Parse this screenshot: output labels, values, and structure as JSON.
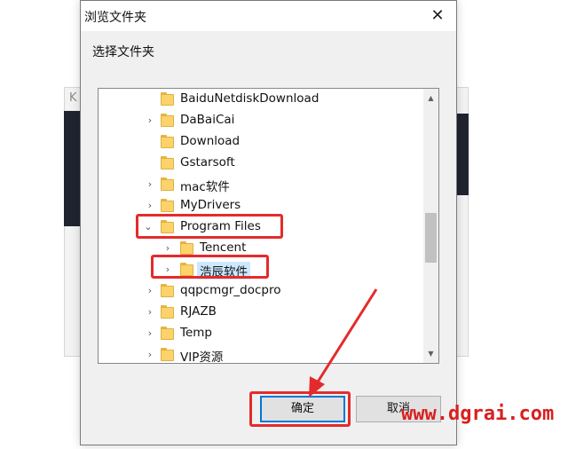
{
  "dialog": {
    "title": "浏览文件夹",
    "close_label": "✕",
    "prompt": "选择文件夹",
    "ok_label": "确定",
    "cancel_label": "取消"
  },
  "background": {
    "letter": "K"
  },
  "tree": {
    "items": [
      {
        "label": "BaiduNetdiskDownload",
        "expander": ""
      },
      {
        "label": "DaBaiCai",
        "expander": "›"
      },
      {
        "label": "Download",
        "expander": ""
      },
      {
        "label": "Gstarsoft",
        "expander": ""
      },
      {
        "label": "mac软件",
        "expander": "›"
      },
      {
        "label": "MyDrivers",
        "expander": "›"
      },
      {
        "label": "Program Files",
        "expander": "⌄"
      },
      {
        "label": "Tencent",
        "expander": "›"
      },
      {
        "label": "浩辰软件",
        "expander": "›"
      },
      {
        "label": "qqpcmgr_docpro",
        "expander": "›"
      },
      {
        "label": "RJAZB",
        "expander": "›"
      },
      {
        "label": "Temp",
        "expander": "›"
      },
      {
        "label": "VIP资源",
        "expander": "›"
      }
    ],
    "selected_item": "浩辰软件"
  },
  "scrollbar": {
    "up_icon": "▲",
    "down_icon": "▼"
  },
  "watermark": "www.dgrai.com",
  "colors": {
    "annotation_red": "#e42b2b",
    "selection_bg": "#cce8ff",
    "folder_yellow": "#fcd36a",
    "focus_blue": "#0078d7"
  }
}
